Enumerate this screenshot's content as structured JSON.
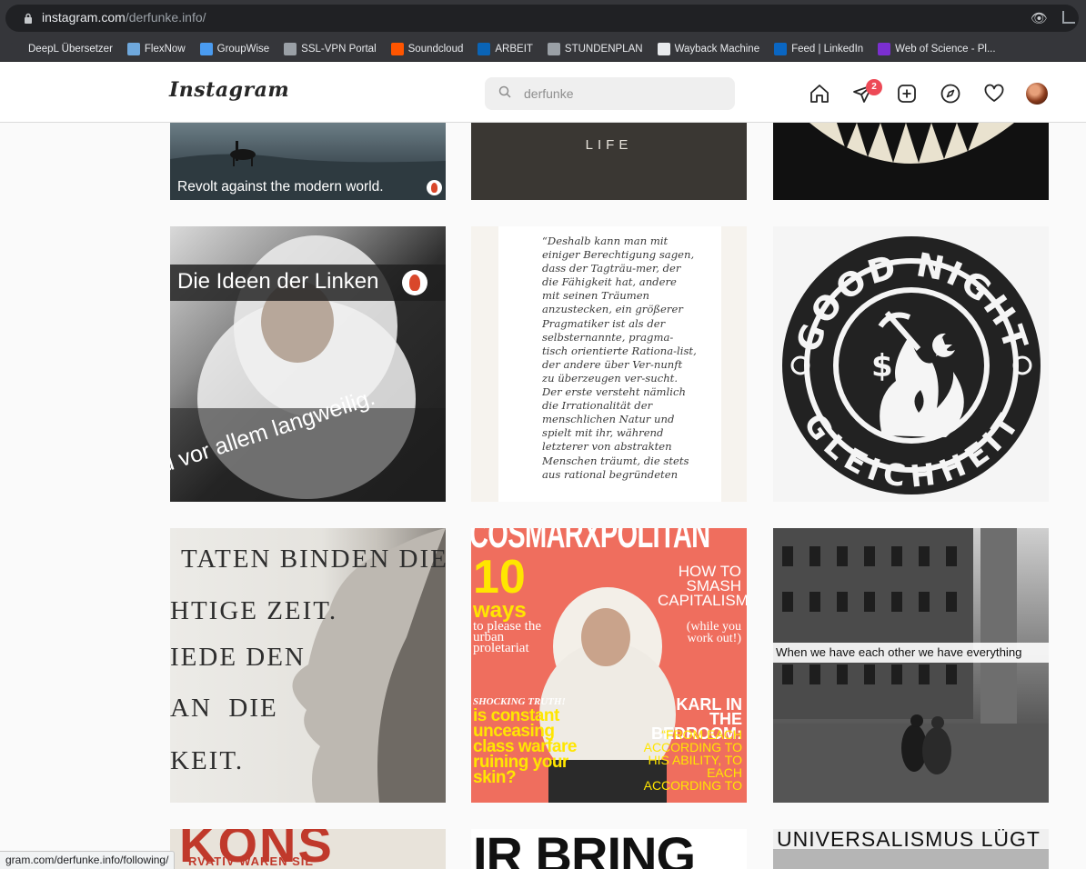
{
  "browser": {
    "url_host": "instagram.com",
    "url_path": "/derfunke.info/",
    "status_url": "gram.com/derfunke.info/following/"
  },
  "bookmarks": [
    {
      "label": "DeepL Übersetzer",
      "icon": "deepl-icon",
      "color": "#35363a"
    },
    {
      "label": "FlexNow",
      "icon": "flexnow-icon",
      "color": "#6fa8dc"
    },
    {
      "label": "GroupWise",
      "icon": "mail-icon",
      "color": "#4a9bf0"
    },
    {
      "label": "SSL-VPN Portal",
      "icon": "globe-icon",
      "color": "#9aa0a6"
    },
    {
      "label": "Soundcloud",
      "icon": "soundcloud-icon",
      "color": "#ff5500"
    },
    {
      "label": "ARBEIT",
      "icon": "outlook-icon",
      "color": "#0a64b6"
    },
    {
      "label": "STUNDENPLAN",
      "icon": "globe-icon",
      "color": "#9aa0a6"
    },
    {
      "label": "Wayback Machine",
      "icon": "archive-icon",
      "color": "#e8eaed"
    },
    {
      "label": "Feed | LinkedIn",
      "icon": "linkedin-icon",
      "color": "#0a66c2"
    },
    {
      "label": "Web of Science - Pl...",
      "icon": "wos-icon",
      "color": "#7b2fd0"
    }
  ],
  "header": {
    "logo": "Instagram",
    "search_value": "derfunke",
    "messages_badge": "2"
  },
  "posts": {
    "p1_caption": "Revolt against the modern world.",
    "p2_caption": "LIFE",
    "p4_caption_top": "Die Ideen der Linken",
    "p4_caption_bottom": "d vor allem langweilig.",
    "p5_quote": "“Deshalb kann man mit einiger Berechtigung sagen, dass der Tagträu-mer, der die Fähigkeit hat, andere mit seinen Träumen anzustecken, ein größerer Pragmatiker ist als der selbsternannte, pragma-tisch orientierte Rationa-list, der andere über Ver-nunft zu überzeugen ver-sucht. Der erste versteht nämlich die Irrationalität der menschlichen Natur und spielt mit ihr, während letzterer von abstrakten Menschen träumt, die stets aus rational begründeten",
    "p6_top": "GOOD NIGHT",
    "p6_bottom": "GLEICHHEIT",
    "p7_lines": [
      "TATEN BINDEN DIE",
      "HTIGE ZEIT.",
      "IEDE DEN",
      "AN  DIE",
      "KEIT."
    ],
    "p8_masthead": "COSMARXPOLITAN",
    "p8_ten": "10",
    "p8_ways": "ways",
    "p8_please": "to please the urban proletariat",
    "p8_smash": "HOW TO SMASH CAPITALISM",
    "p8_while": "(while you work out!)",
    "p8_shocking": "SHOCKING TRUTH!",
    "p8_constant": "is constant unceasing class warfare ruining your skin?",
    "p8_karl": "KARL IN THE BEDROOM:",
    "p8_each": "“FROM EACH ACCORDING TO HIS ABILITY, TO EACH ACCORDING TO",
    "p9_caption": "When we have each other we have everything",
    "p10_text": "KONS",
    "p10_sub": "RVATIV WAREN SIE",
    "p11_text": "IR BRING",
    "p12_text": "UNIVERSALISMUS LÜGT"
  }
}
